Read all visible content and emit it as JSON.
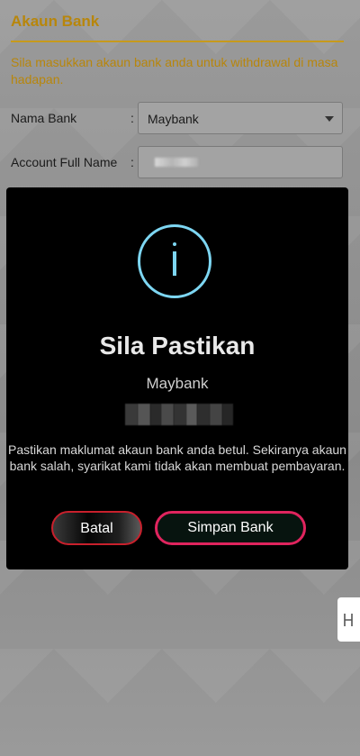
{
  "page": {
    "title": "Akaun Bank",
    "description": "Sila masukkan akaun bank anda untuk withdrawal di masa hadapan.",
    "fields": {
      "bank_label": "Nama Bank",
      "bank_colon": ":",
      "bank_value": "Maybank",
      "account_label": "Account Full Name",
      "account_colon": ":"
    }
  },
  "modal": {
    "icon": "info-icon",
    "title": "Sila Pastikan",
    "bank_name": "Maybank",
    "message": "Pastikan maklumat akaun bank anda betul. Sekiranya akaun bank salah, syarikat kami tidak akan membuat pembayaran.",
    "cancel_label": "Batal",
    "save_label": "Simpan Bank"
  },
  "colors": {
    "accent_gold": "#c79a1c",
    "info_blue": "#7dd6f2",
    "cancel_border": "#c8202c",
    "save_border": "#e0245e"
  }
}
